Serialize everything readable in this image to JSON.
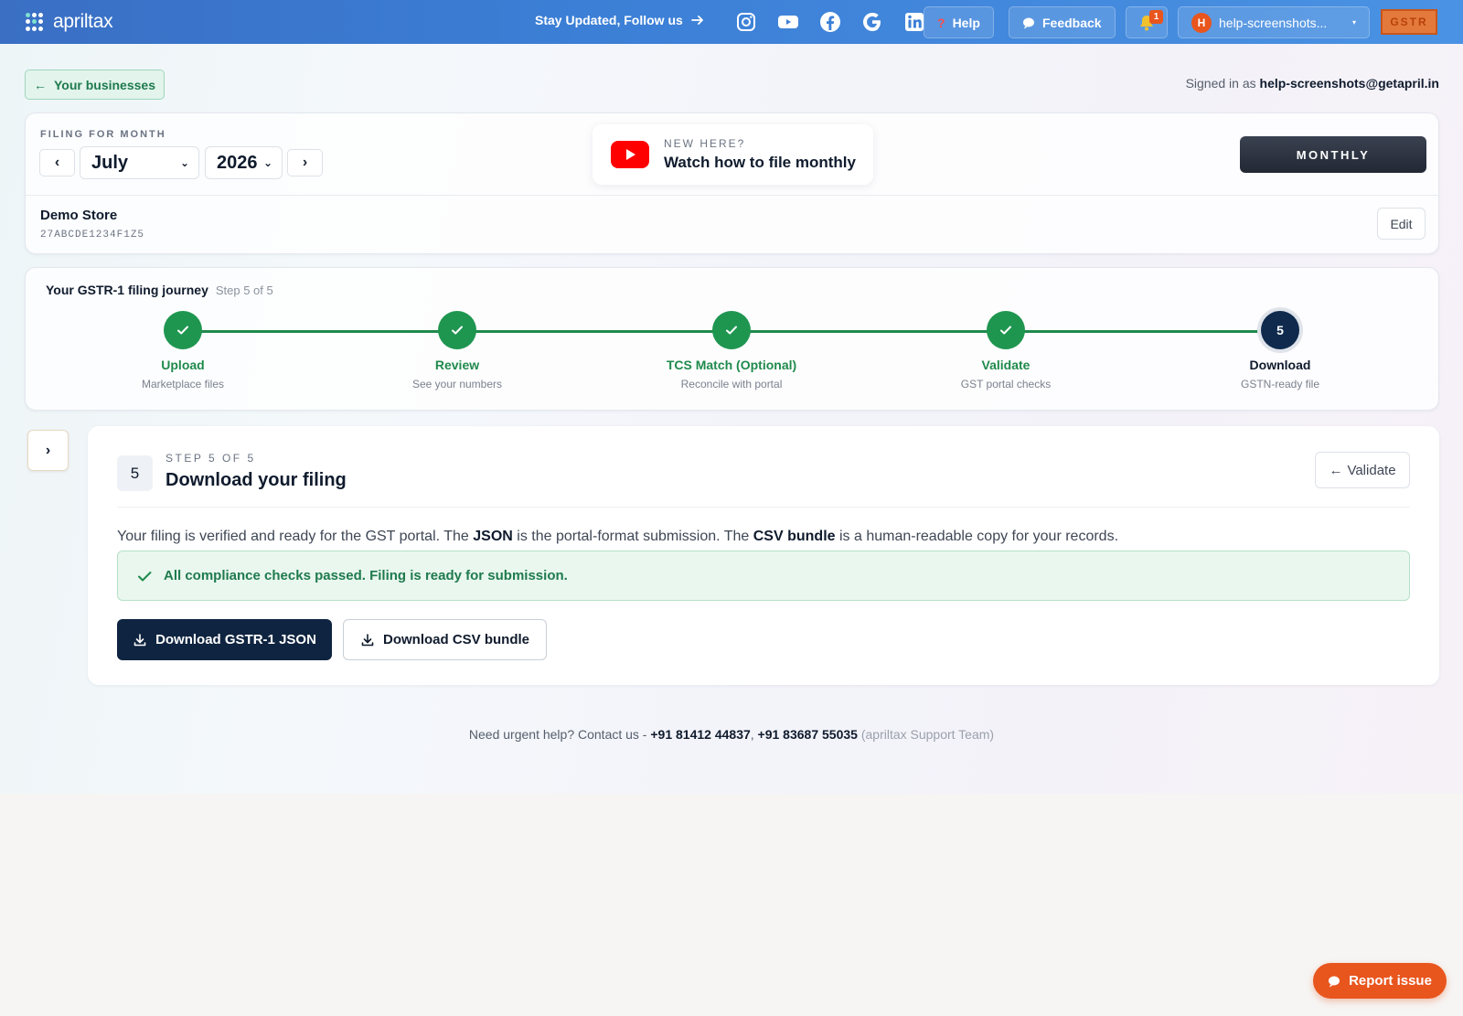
{
  "nav": {
    "brand": "apriltax",
    "follow_text": "Stay Updated, Follow us",
    "social": [
      "instagram-icon",
      "youtube-icon",
      "facebook-icon",
      "google-icon",
      "linkedin-icon"
    ],
    "help_label": "Help",
    "feedback_label": "Feedback",
    "notification_count": "1",
    "user_initial": "H",
    "user_name": "help-screenshots...",
    "gstr_label": "GSTR"
  },
  "header": {
    "back_label": "Your businesses",
    "signed_in_prefix": "Signed in as",
    "signed_in_email": "help-screenshots@getapril.in"
  },
  "filing": {
    "label": "FILING FOR MONTH",
    "month": "July",
    "year": "2026",
    "video_eyebrow": "NEW HERE?",
    "video_title": "Watch how to file monthly",
    "frequency": "MONTHLY",
    "store_name": "Demo Store",
    "gstin": "27ABCDE1234F1Z5",
    "edit_label": "Edit"
  },
  "journey": {
    "title": "Your GSTR-1 filing journey",
    "step_text": "Step 5 of 5",
    "steps": [
      {
        "label": "Upload",
        "sub": "Marketplace files",
        "status": "done"
      },
      {
        "label": "Review",
        "sub": "See your numbers",
        "status": "done"
      },
      {
        "label": "TCS Match (Optional)",
        "sub": "Reconcile with portal",
        "status": "done"
      },
      {
        "label": "Validate",
        "sub": "GST portal checks",
        "status": "done"
      },
      {
        "label": "Download",
        "sub": "GSTN-ready file",
        "status": "current",
        "number": "5"
      }
    ]
  },
  "main": {
    "step_number": "5",
    "eyebrow": "STEP 5 OF 5",
    "title": "Download your filing",
    "back_label": "Validate",
    "desc_1": "Your filing is verified and ready for the GST portal. The ",
    "desc_json": "JSON",
    "desc_2": " is the portal-format submission. The ",
    "desc_csv": "CSV bundle",
    "desc_3": " is a human-readable copy for your records.",
    "success_text": "All compliance checks passed. Filing is ready for submission.",
    "download_json_label": "Download GSTR-1 JSON",
    "download_csv_label": "Download CSV bundle"
  },
  "footer": {
    "prefix": "Need urgent help? Contact us -",
    "phone_1": "+91 81412 44837",
    "separator": ",",
    "phone_2": "+91 83687 55035",
    "team": "(apriltax Support Team)"
  },
  "report_label": "Report issue",
  "colors": {
    "nav_blue": "#3b7fd6",
    "success_green": "#1f9650",
    "navy": "#0f2440",
    "orange": "#e8551d"
  }
}
